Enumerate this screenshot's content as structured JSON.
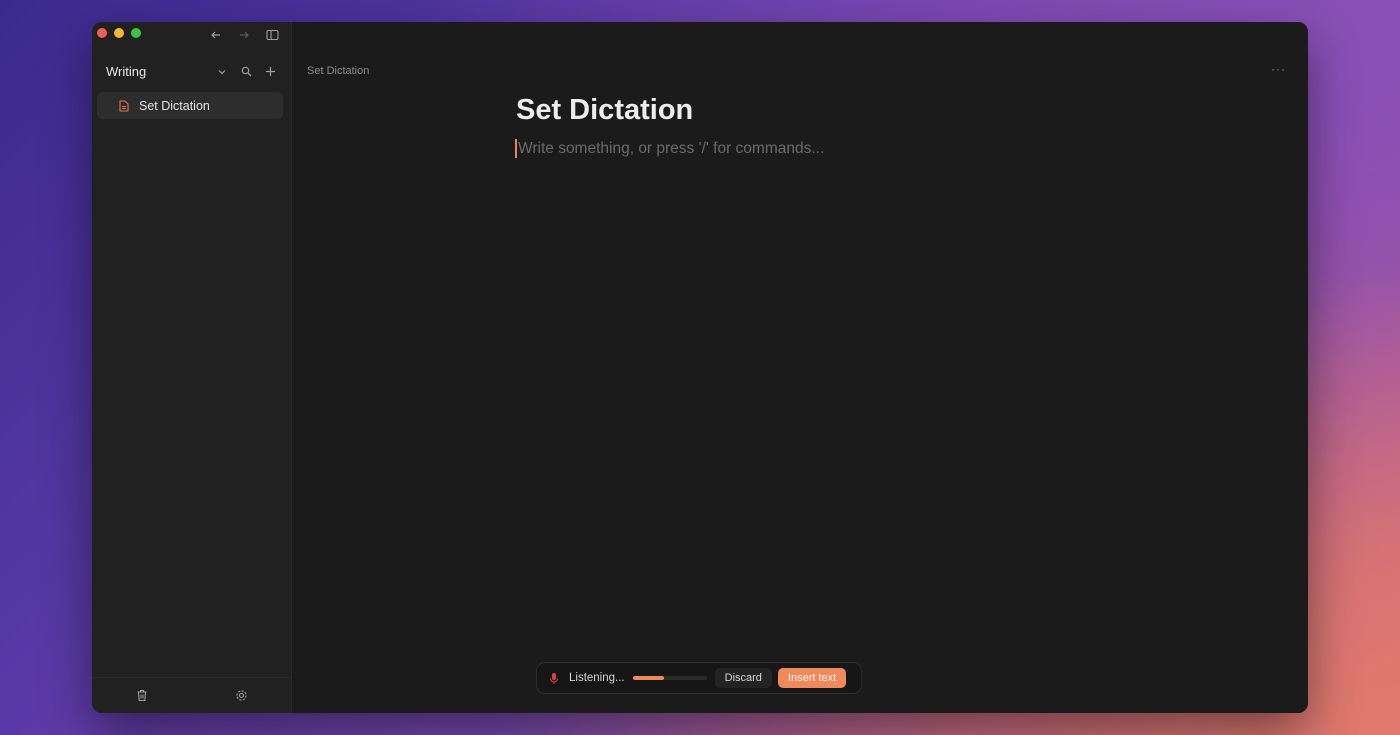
{
  "window": {
    "traffic_lights": [
      "close",
      "minimize",
      "zoom"
    ]
  },
  "sidebar": {
    "workspace_name": "Writing",
    "top_icons": [
      "arrow-left-icon",
      "arrow-right-icon",
      "sidebar-toggle-icon"
    ],
    "workspace_icons": [
      "chevron-down-icon",
      "search-icon",
      "plus-icon"
    ],
    "documents": [
      {
        "label": "Set Dictation",
        "icon": "document-icon",
        "active": true
      }
    ],
    "bottom_icons": [
      "trash-icon",
      "gear-icon"
    ]
  },
  "main": {
    "breadcrumb": "Set Dictation",
    "more_label": "···",
    "title": "Set Dictation",
    "placeholder": "Write something, or press '/' for commands..."
  },
  "dictation": {
    "status": "Listening...",
    "level": 0.42,
    "discard_label": "Discard",
    "insert_label": "Insert text"
  },
  "colors": {
    "accent": "#f08a5d",
    "mic": "#d9433a",
    "doc_icon": "#e8724f"
  }
}
